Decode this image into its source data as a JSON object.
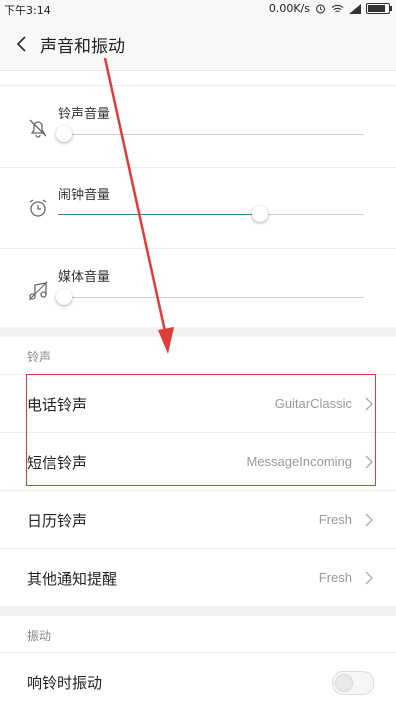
{
  "status_bar": {
    "time": "下午3:14",
    "network_speed": "0.00K/s",
    "icons": [
      "alarm-icon",
      "wifi-icon",
      "signal-icon",
      "battery-icon"
    ]
  },
  "header": {
    "title": "声音和振动",
    "back_icon": "chevron-left-icon"
  },
  "volume": {
    "items": [
      {
        "label": "铃声音量",
        "icon": "bell-muted-icon",
        "level": 0.02
      },
      {
        "label": "闹钟音量",
        "icon": "alarm-clock-icon",
        "level": 0.66
      },
      {
        "label": "媒体音量",
        "icon": "music-note-icon",
        "level": 0.02
      }
    ],
    "accent_color": "#2c8c98"
  },
  "ringtone_section": {
    "title": "铃声",
    "items": [
      {
        "label": "电话铃声",
        "value": "GuitarClassic"
      },
      {
        "label": "短信铃声",
        "value": "MessageIncoming"
      },
      {
        "label": "日历铃声",
        "value": "Fresh"
      },
      {
        "label": "其他通知提醒",
        "value": "Fresh"
      }
    ]
  },
  "vibration_section": {
    "title": "振动",
    "items": [
      {
        "label": "响铃时振动",
        "enabled": false
      }
    ]
  },
  "annotation": {
    "color": "#e23b3b"
  }
}
